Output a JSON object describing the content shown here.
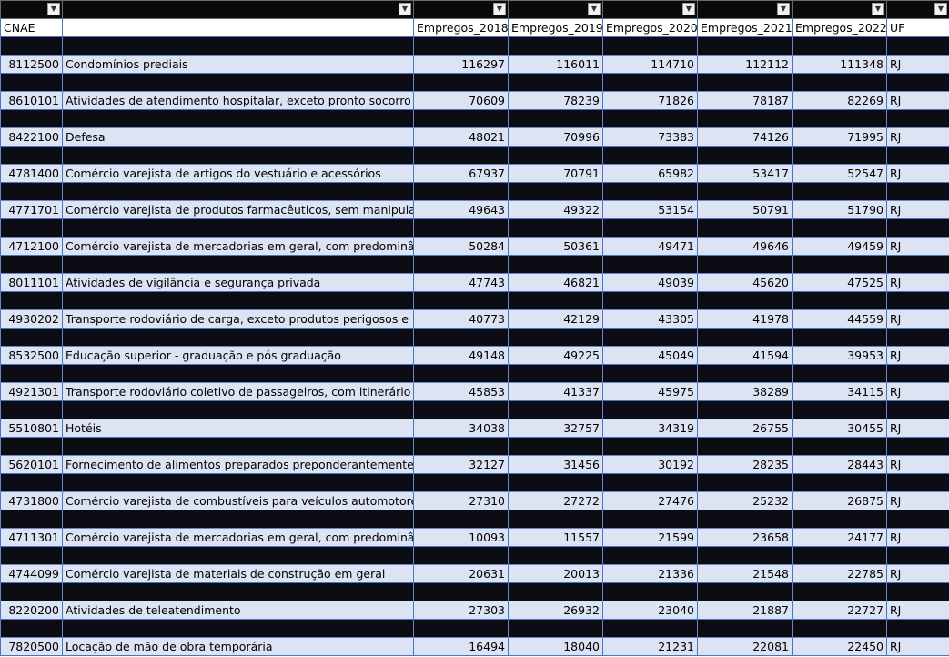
{
  "sheet": {
    "headers": [
      "CNAE",
      "",
      "Empregos_2018",
      "Empregos_2019",
      "Empregos_2020",
      "Empregos_2021",
      "Empregos_2022",
      "UF"
    ],
    "filter_icon": "chevron-down-icon",
    "rows": [
      {
        "cnae": "8112500",
        "desc": "Condomínios prediais",
        "y2018": "116297",
        "y2019": "116011",
        "y2020": "114710",
        "y2021": "112112",
        "y2022": "111348",
        "uf": "RJ"
      },
      {
        "cnae": "8610101",
        "desc": "Atividades de atendimento hospitalar, exceto pronto socorro e",
        "y2018": "70609",
        "y2019": "78239",
        "y2020": "71826",
        "y2021": "78187",
        "y2022": "82269",
        "uf": "RJ"
      },
      {
        "cnae": "8422100",
        "desc": "Defesa",
        "y2018": "48021",
        "y2019": "70996",
        "y2020": "73383",
        "y2021": "74126",
        "y2022": "71995",
        "uf": "RJ"
      },
      {
        "cnae": "4781400",
        "desc": " Comércio varejista de artigos do vestuário e acessórios",
        "y2018": "67937",
        "y2019": "70791",
        "y2020": "65982",
        "y2021": "53417",
        "y2022": "52547",
        "uf": "RJ"
      },
      {
        "cnae": "4771701",
        "desc": "Comércio varejista de produtos farmacêuticos, sem manipulaç",
        "y2018": "49643",
        "y2019": "49322",
        "y2020": "53154",
        "y2021": "50791",
        "y2022": "51790",
        "uf": "RJ"
      },
      {
        "cnae": "4712100",
        "desc": "Comércio varejista de mercadorias em geral, com predominân",
        "y2018": "50284",
        "y2019": "50361",
        "y2020": "49471",
        "y2021": "49646",
        "y2022": "49459",
        "uf": "RJ"
      },
      {
        "cnae": "8011101",
        "desc": "Atividades de vigilância e segurança privada",
        "y2018": "47743",
        "y2019": "46821",
        "y2020": "49039",
        "y2021": "45620",
        "y2022": "47525",
        "uf": "RJ"
      },
      {
        "cnae": "4930202",
        "desc": " Transporte rodoviário de carga, exceto produtos perigosos e m",
        "y2018": "40773",
        "y2019": "42129",
        "y2020": "43305",
        "y2021": "41978",
        "y2022": "44559",
        "uf": "RJ"
      },
      {
        "cnae": "8532500",
        "desc": " Educação superior - graduação e pós graduação",
        "y2018": "49148",
        "y2019": "49225",
        "y2020": "45049",
        "y2021": "41594",
        "y2022": "39953",
        "uf": "RJ"
      },
      {
        "cnae": "4921301",
        "desc": "Transporte rodoviário coletivo de passageiros, com itinerário f",
        "y2018": "45853",
        "y2019": "41337",
        "y2020": "45975",
        "y2021": "38289",
        "y2022": "34115",
        "uf": "RJ"
      },
      {
        "cnae": "5510801",
        "desc": "Hotéis",
        "y2018": "34038",
        "y2019": "32757",
        "y2020": "34319",
        "y2021": "26755",
        "y2022": "30455",
        "uf": "RJ"
      },
      {
        "cnae": "5620101",
        "desc": "Fornecimento de alimentos preparados preponderantemente",
        "y2018": "32127",
        "y2019": "31456",
        "y2020": "30192",
        "y2021": "28235",
        "y2022": "28443",
        "uf": "RJ"
      },
      {
        "cnae": "4731800",
        "desc": "Comércio varejista de combustíveis para veículos automotores",
        "y2018": "27310",
        "y2019": "27272",
        "y2020": "27476",
        "y2021": "25232",
        "y2022": "26875",
        "uf": "RJ"
      },
      {
        "cnae": "4711301",
        "desc": "Comércio varejista de mercadorias em geral, com predominân",
        "y2018": "10093",
        "y2019": "11557",
        "y2020": "21599",
        "y2021": "23658",
        "y2022": "24177",
        "uf": "RJ"
      },
      {
        "cnae": "4744099",
        "desc": "Comércio varejista de materiais de construção em geral",
        "y2018": "20631",
        "y2019": "20013",
        "y2020": "21336",
        "y2021": "21548",
        "y2022": "22785",
        "uf": "RJ"
      },
      {
        "cnae": "8220200",
        "desc": "Atividades de teleatendimento",
        "y2018": "27303",
        "y2019": "26932",
        "y2020": "23040",
        "y2021": "21887",
        "y2022": "22727",
        "uf": "RJ"
      },
      {
        "cnae": "7820500",
        "desc": "Locação de mão de obra temporária",
        "y2018": "16494",
        "y2019": "18040",
        "y2020": "21231",
        "y2021": "22081",
        "y2022": "22450",
        "uf": "RJ"
      }
    ]
  }
}
